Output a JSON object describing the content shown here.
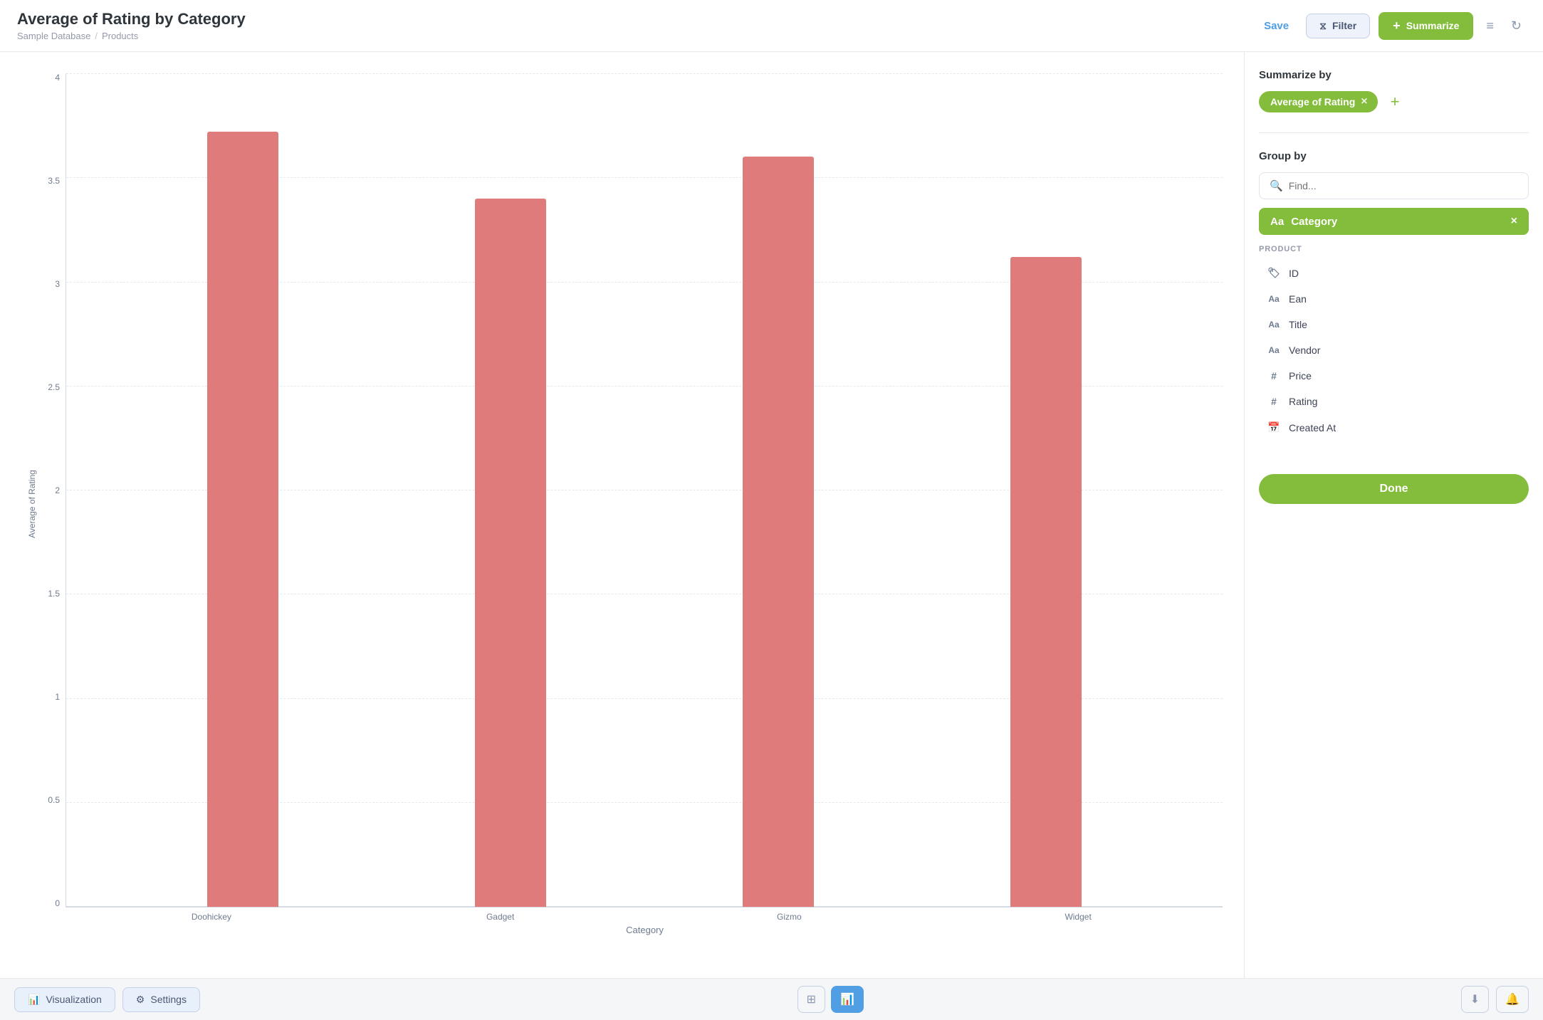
{
  "header": {
    "title": "Average of Rating by Category",
    "breadcrumb": {
      "database": "Sample Database",
      "separator": "/",
      "table": "Products"
    },
    "actions": {
      "save": "Save",
      "filter": "Filter",
      "summarize": "Summarize"
    }
  },
  "chart": {
    "y_axis_label": "Average of Rating",
    "x_axis_label": "Category",
    "y_ticks": [
      "4",
      "3.5",
      "3",
      "2.5",
      "2",
      "1.5",
      "1",
      "0.5",
      "0"
    ],
    "bars": [
      {
        "label": "Doohickey",
        "value": 3.73,
        "height_pct": 93
      },
      {
        "label": "Gadget",
        "value": 3.43,
        "height_pct": 85
      },
      {
        "label": "Gizmo",
        "value": 3.63,
        "height_pct": 90
      },
      {
        "label": "Widget",
        "value": 3.15,
        "height_pct": 78
      }
    ],
    "bar_color": "#e07b7b"
  },
  "summarize_panel": {
    "summarize_by_title": "Summarize by",
    "summarize_pill": "Average of Rating",
    "add_icon": "+",
    "group_by_title": "Group by",
    "search_placeholder": "Find...",
    "group_pill": "Category",
    "product_section_label": "PRODUCT",
    "fields": [
      {
        "icon": "🏷",
        "icon_type": "tag",
        "name": "ID"
      },
      {
        "icon": "Aa",
        "icon_type": "text",
        "name": "Ean"
      },
      {
        "icon": "Aa",
        "icon_type": "text",
        "name": "Title"
      },
      {
        "icon": "Aa",
        "icon_type": "text",
        "name": "Vendor"
      },
      {
        "icon": "#",
        "icon_type": "number",
        "name": "Price"
      },
      {
        "icon": "#",
        "icon_type": "number",
        "name": "Rating"
      },
      {
        "icon": "📅",
        "icon_type": "calendar",
        "name": "Created At"
      }
    ],
    "done_label": "Done"
  },
  "bottom_bar": {
    "visualization_label": "Visualization",
    "settings_label": "Settings"
  }
}
